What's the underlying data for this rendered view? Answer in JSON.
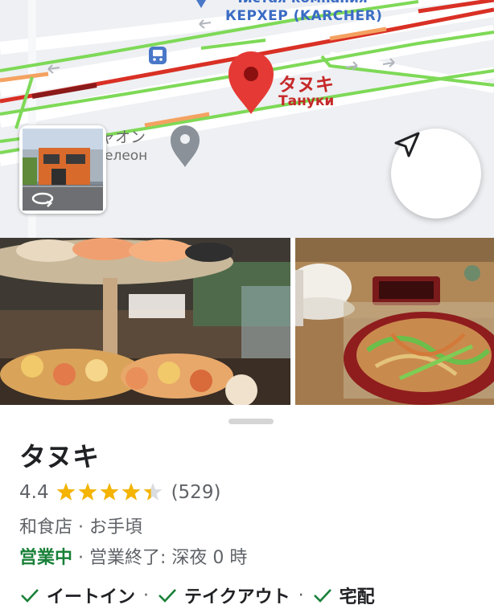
{
  "map": {
    "poi_karcher_line1": "Чистая компания",
    "poi_karcher_line2": "КЕРХЕР (KARCHER)",
    "pin_label_jp": "タヌキ",
    "pin_label_ru": "Тануки",
    "poi_chameleon_line1": "ャオン",
    "poi_chameleon_line2": "елеон",
    "street_view_icon": "rotate-360-icon",
    "recenter_icon": "navigation-arrow-icon",
    "colors": {
      "traffic_red": "#d93025",
      "traffic_green": "#7ed957",
      "traffic_orange": "#f4a261",
      "pin": "#e53935"
    }
  },
  "photos": [
    {
      "subject": "sushi-tower-photo"
    },
    {
      "subject": "noodle-dish-photo"
    }
  ],
  "place": {
    "name": "タヌキ",
    "rating": "4.4",
    "stars": 4.4,
    "review_count": "(529)",
    "category": "和食店 · お手頃",
    "open_status": "営業中",
    "separator": " · ",
    "closing_time": "営業終了: 深夜 0 時",
    "services": [
      {
        "label": "イートイン"
      },
      {
        "label": "テイクアウト"
      },
      {
        "label": "宅配"
      }
    ],
    "service_separator": "·",
    "colors": {
      "open": "#188038",
      "star": "#f4b400",
      "check": "#188038"
    }
  }
}
